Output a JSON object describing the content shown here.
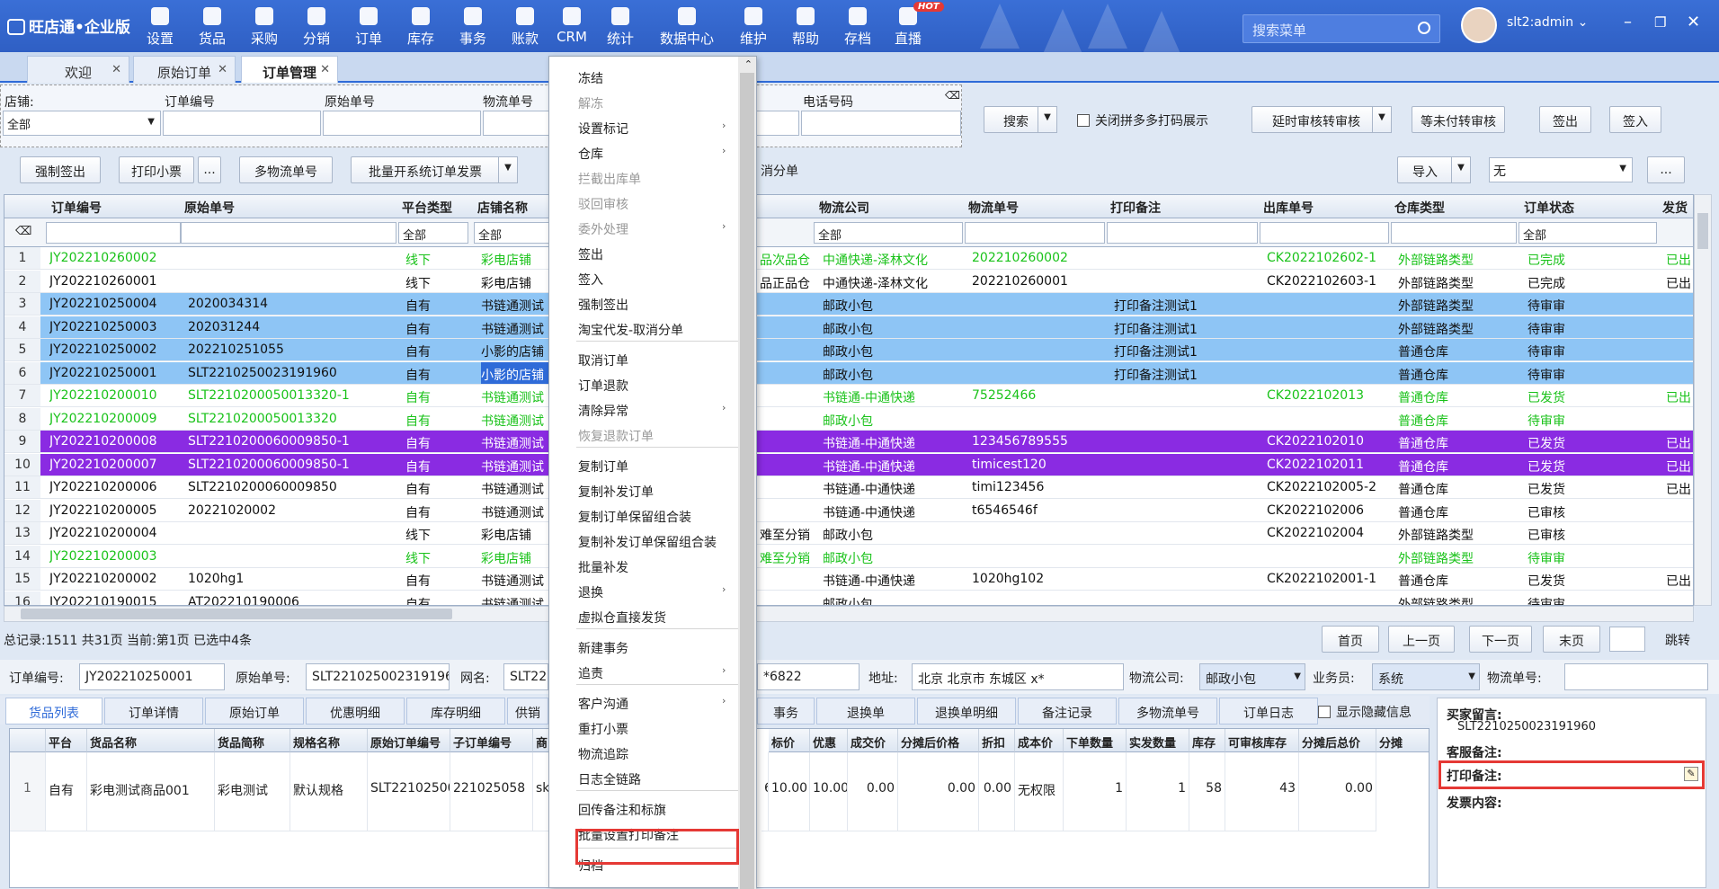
{
  "app": {
    "logo": "旺店通•企业版",
    "user": "slt2:admin"
  },
  "nav": [
    "设置",
    "货品",
    "采购",
    "分销",
    "订单",
    "库存",
    "事务",
    "账款",
    "CRM",
    "统计",
    "数据中心",
    "维护",
    "帮助",
    "存档",
    "直播"
  ],
  "nav_badge": "HOT",
  "search_placeholder": "搜索菜单",
  "tabs": [
    "欢迎",
    "原始订单",
    "订单管理"
  ],
  "filters": {
    "shop_label": "店铺:",
    "shop_value": "全部",
    "order_no_label": "订单编号",
    "raw_no_label": "原始单号",
    "logistics_no_label": "物流单号",
    "phone_label": "电话号码"
  },
  "toolbar": {
    "search": "搜索",
    "close_pdd": "关闭拼多多打码展示",
    "delay": "延时审核转审核",
    "wait": "等未付转审核",
    "checkout": "签出",
    "checkin": "签入",
    "force_out": "强制签出",
    "print_ticket": "打印小票",
    "more": "...",
    "multi_logistics": "多物流单号",
    "batch_invoice": "批量开系统订单发票",
    "cancel_split": "消分单",
    "import": "导入",
    "none": "无",
    "ellipsis": "..."
  },
  "grid": {
    "headers": [
      "订单编号",
      "原始单号",
      "平台类型",
      "店铺名称",
      "物流公司",
      "物流单号",
      "打印备注",
      "出库单号",
      "仓库类型",
      "订单状态",
      "发货"
    ],
    "filter_all": "全部",
    "rows": [
      {
        "n": "1",
        "order": "JY202210260002",
        "raw": "",
        "plat": "线下",
        "shop": "彩电店铺",
        "mid": "品次品仓",
        "log": "中通快递-泽林文化",
        "lno": "202210260002",
        "pn": "",
        "out": "CK2022102602-1",
        "wh": "外部链路类型",
        "st": "已完成",
        "fh": "已出"
      },
      {
        "n": "2",
        "order": "JY202210260001",
        "raw": "",
        "plat": "线下",
        "shop": "彩电店铺",
        "mid": "品正品仓",
        "log": "中通快递-泽林文化",
        "lno": "202210260001",
        "pn": "",
        "out": "CK2022102603-1",
        "wh": "外部链路类型",
        "st": "已完成",
        "fh": "已出"
      },
      {
        "n": "3",
        "order": "JY202210250004",
        "raw": "2020034314",
        "plat": "自有",
        "shop": "书链通测试",
        "mid": "",
        "log": "邮政小包",
        "lno": "",
        "pn": "打印备注测试1",
        "out": "",
        "wh": "外部链路类型",
        "st": "待审审",
        "fh": ""
      },
      {
        "n": "4",
        "order": "JY202210250003",
        "raw": "202031244",
        "plat": "自有",
        "shop": "书链通测试",
        "mid": "",
        "log": "邮政小包",
        "lno": "",
        "pn": "打印备注测试1",
        "out": "",
        "wh": "外部链路类型",
        "st": "待审审",
        "fh": ""
      },
      {
        "n": "5",
        "order": "JY202210250002",
        "raw": "202210251055",
        "plat": "自有",
        "shop": "小影的店铺",
        "mid": "",
        "log": "邮政小包",
        "lno": "",
        "pn": "打印备注测试1",
        "out": "",
        "wh": "普通仓库",
        "st": "待审审",
        "fh": ""
      },
      {
        "n": "6",
        "order": "JY202210250001",
        "raw": "SLT2210250023191960",
        "plat": "自有",
        "shop": "小影的店铺",
        "mid": "",
        "log": "邮政小包",
        "lno": "",
        "pn": "打印备注测试1",
        "out": "",
        "wh": "普通仓库",
        "st": "待审审",
        "fh": ""
      },
      {
        "n": "7",
        "order": "JY202210200010",
        "raw": "SLT2210200050013320-1",
        "plat": "自有",
        "shop": "书链通测试",
        "mid": "",
        "log": "书链通-中通快递",
        "lno": "75252466",
        "pn": "",
        "out": "CK2022102013",
        "wh": "普通仓库",
        "st": "已发货",
        "fh": "已出"
      },
      {
        "n": "8",
        "order": "JY202210200009",
        "raw": "SLT2210200050013320",
        "plat": "自有",
        "shop": "书链通测试",
        "mid": "",
        "log": "邮政小包",
        "lno": "",
        "pn": "",
        "out": "",
        "wh": "普通仓库",
        "st": "待审审",
        "fh": ""
      },
      {
        "n": "9",
        "order": "JY202210200008",
        "raw": "SLT2210200060009850-1",
        "plat": "自有",
        "shop": "书链通测试",
        "mid": "",
        "log": "书链通-中通快递",
        "lno": "123456789555",
        "pn": "",
        "out": "CK2022102010",
        "wh": "普通仓库",
        "st": "已发货",
        "fh": "已出"
      },
      {
        "n": "10",
        "order": "JY202210200007",
        "raw": "SLT2210200060009850-1",
        "plat": "自有",
        "shop": "书链通测试",
        "mid": "",
        "log": "书链通-中通快递",
        "lno": "timicest120",
        "pn": "",
        "out": "CK2022102011",
        "wh": "普通仓库",
        "st": "已发货",
        "fh": "已出"
      },
      {
        "n": "11",
        "order": "JY202210200006",
        "raw": "SLT2210200060009850",
        "plat": "自有",
        "shop": "书链通测试",
        "mid": "",
        "log": "书链通-中通快递",
        "lno": "timi123456",
        "pn": "",
        "out": "CK2022102005-2",
        "wh": "普通仓库",
        "st": "已发货",
        "fh": "已出"
      },
      {
        "n": "12",
        "order": "JY202210200005",
        "raw": "20221020002",
        "plat": "自有",
        "shop": "书链通测试",
        "mid": "",
        "log": "书链通-中通快递",
        "lno": "t6546546f",
        "pn": "",
        "out": "CK2022102006",
        "wh": "普通仓库",
        "st": "已审核",
        "fh": ""
      },
      {
        "n": "13",
        "order": "JY202210200004",
        "raw": "",
        "plat": "线下",
        "shop": "彩电店铺",
        "mid": "难至分销",
        "log": "邮政小包",
        "lno": "",
        "pn": "",
        "out": "CK2022102004",
        "wh": "外部链路类型",
        "st": "已审核",
        "fh": ""
      },
      {
        "n": "14",
        "order": "JY202210200003",
        "raw": "",
        "plat": "线下",
        "shop": "彩电店铺",
        "mid": "难至分销",
        "log": "邮政小包",
        "lno": "",
        "pn": "",
        "out": "",
        "wh": "外部链路类型",
        "st": "待审审",
        "fh": ""
      },
      {
        "n": "15",
        "order": "JY202210200002",
        "raw": "1020hg1",
        "plat": "自有",
        "shop": "书链通测试",
        "mid": "",
        "log": "书链通-中通快递",
        "lno": "1020hg102",
        "pn": "",
        "out": "CK2022102001-1",
        "wh": "普通仓库",
        "st": "已发货",
        "fh": "已出"
      },
      {
        "n": "16",
        "order": "JY202210190015",
        "raw": "AT202210190006",
        "plat": "自有",
        "shop": "书链通测试",
        "mid": "",
        "log": "邮政小包",
        "lno": "",
        "pn": "",
        "out": "",
        "wh": "外部链路类型",
        "st": "待审审",
        "fh": ""
      }
    ]
  },
  "summary": "总记录:1511  共31页  当前:第1页  已选中4条",
  "pager": [
    "首页",
    "上一页",
    "下一页",
    "末页",
    "跳转"
  ],
  "detail": {
    "order_label": "订单编号:",
    "order_value": "JY202210250001",
    "raw_label": "原始单号:",
    "raw_value": "SLT2210250023191960",
    "net_label": "网名:",
    "net_value": "SLT22",
    "phone_value": "*6822",
    "addr_label": "地址:",
    "addr_value": "北京 北京市 东城区 x*",
    "logi_label": "物流公司:",
    "logi_value": "邮政小包",
    "sales_label": "业务员:",
    "sales_value": "系统",
    "lno_label": "物流单号:"
  },
  "bottom_tabs": [
    "货品列表",
    "订单详情",
    "原始订单",
    "优惠明细",
    "库存明细",
    "供销",
    "事务",
    "退换单",
    "退换单明细",
    "备注记录",
    "多物流单号",
    "订单日志"
  ],
  "show_hidden": "显示隐藏信息",
  "btable": {
    "headers": [
      "平台",
      "货品名称",
      "货品简称",
      "规格名称",
      "原始订单编号",
      "子订单编号",
      "商",
      "标价",
      "优惠",
      "成交价",
      "分摊后价格",
      "折扣",
      "成本价",
      "下单数量",
      "实发数量",
      "库存",
      "可审核库存",
      "分摊后总价",
      "分摊"
    ],
    "row": [
      "1",
      "自有",
      "彩电测试商品001",
      "彩电测试",
      "默认规格",
      "SLT22102500",
      "221025058",
      "sk",
      "6",
      "10.00",
      "10.00",
      "0.00",
      "0.00",
      "0.00",
      "无权限",
      "1",
      "1",
      "58",
      "43",
      "0.00"
    ]
  },
  "rpanel": {
    "buyer": "买家留言:",
    "buyer_val": "SLT2210250023191960",
    "service": "客服备注:",
    "print": "打印备注:",
    "invoice": "发票内容:"
  },
  "menu": [
    "冻结",
    "解冻",
    "设置标记",
    "仓库",
    "拦截出库单",
    "驳回审核",
    "委外处理",
    "签出",
    "签入",
    "强制签出",
    "淘宝代发-取消分单",
    "取消订单",
    "订单退款",
    "清除异常",
    "恢复退款订单",
    "复制订单",
    "复制补发订单",
    "复制订单保留组合装",
    "复制补发订单保留组合装",
    "批量补发",
    "退换",
    "虚拟仓直接发货",
    "新建事务",
    "追责",
    "客户沟通",
    "重打小票",
    "物流追踪",
    "日志全链路",
    "回传备注和标旗",
    "批量设置打印备注",
    "归档"
  ],
  "colors": {
    "accent": "#2f6bd8",
    "green_row": "#19c219",
    "blue_row": "#8ec5f5",
    "purple_row": "#8a2be2",
    "highlight": "#e53935"
  }
}
